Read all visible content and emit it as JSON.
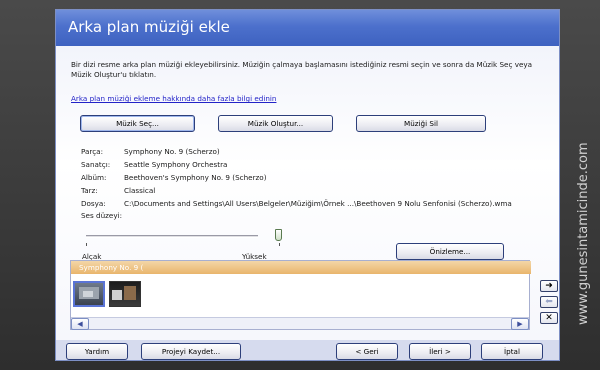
{
  "header": {
    "title": "Arka plan müziği ekle"
  },
  "content": {
    "description": "Bir dizi resme arka plan müziği ekleyebilirsiniz. Müziğin çalmaya başlamasını istediğiniz resmi seçin ve sonra da Müzik Seç veya Müzik Oluştur'u tıklatın.",
    "help_link": "Arka plan müziği ekleme hakkında daha fazla bilgi edinin"
  },
  "buttons": {
    "select": "Müzik Seç...",
    "create": "Müzik Oluştur...",
    "delete": "Müziği Sil",
    "preview": "Önizleme..."
  },
  "track": {
    "labels": {
      "part": "Parça:",
      "artist": "Sanatçı:",
      "album": "Albüm:",
      "genre": "Tarz:",
      "file": "Dosya:"
    },
    "part": "Symphony No. 9 (Scherzo)",
    "artist": "Seattle Symphony Orchestra",
    "album": "Beethoven's Symphony No. 9 (Scherzo)",
    "genre": "Classical",
    "file": "C:\\Documents and Settings\\All Users\\Belgeler\\Müziğim\\Örnek ...\\Beethoven 9 Nolu Senfonisi (Scherzo).wma"
  },
  "volume": {
    "label": "Ses düzeyi:",
    "low": "Alçak",
    "high": "Yüksek",
    "level": 1.0
  },
  "timeline": {
    "tab_label": "Symphony No. 9 ("
  },
  "footer": {
    "help": "Yardım",
    "save": "Projeyi Kaydet...",
    "back": "< Geri",
    "next": "İleri >",
    "cancel": "İptal"
  },
  "watermark": {
    "text": "www.gunesintamicinde.com"
  },
  "colors": {
    "header": "#4c70cc",
    "link": "#2323c8",
    "timeline_tab": "#e9b56c"
  }
}
